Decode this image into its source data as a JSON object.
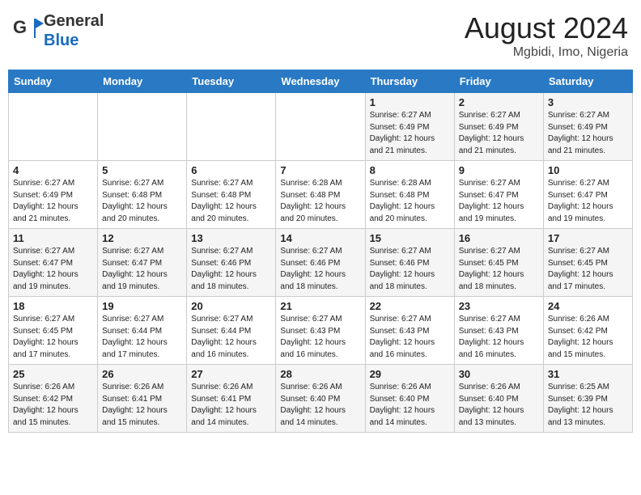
{
  "header": {
    "logo_general": "General",
    "logo_blue": "Blue",
    "month_year": "August 2024",
    "location": "Mgbidi, Imo, Nigeria"
  },
  "weekdays": [
    "Sunday",
    "Monday",
    "Tuesday",
    "Wednesday",
    "Thursday",
    "Friday",
    "Saturday"
  ],
  "weeks": [
    [
      {
        "day": "",
        "info": ""
      },
      {
        "day": "",
        "info": ""
      },
      {
        "day": "",
        "info": ""
      },
      {
        "day": "",
        "info": ""
      },
      {
        "day": "1",
        "info": "Sunrise: 6:27 AM\nSunset: 6:49 PM\nDaylight: 12 hours\nand 21 minutes."
      },
      {
        "day": "2",
        "info": "Sunrise: 6:27 AM\nSunset: 6:49 PM\nDaylight: 12 hours\nand 21 minutes."
      },
      {
        "day": "3",
        "info": "Sunrise: 6:27 AM\nSunset: 6:49 PM\nDaylight: 12 hours\nand 21 minutes."
      }
    ],
    [
      {
        "day": "4",
        "info": "Sunrise: 6:27 AM\nSunset: 6:49 PM\nDaylight: 12 hours\nand 21 minutes."
      },
      {
        "day": "5",
        "info": "Sunrise: 6:27 AM\nSunset: 6:48 PM\nDaylight: 12 hours\nand 20 minutes."
      },
      {
        "day": "6",
        "info": "Sunrise: 6:27 AM\nSunset: 6:48 PM\nDaylight: 12 hours\nand 20 minutes."
      },
      {
        "day": "7",
        "info": "Sunrise: 6:28 AM\nSunset: 6:48 PM\nDaylight: 12 hours\nand 20 minutes."
      },
      {
        "day": "8",
        "info": "Sunrise: 6:28 AM\nSunset: 6:48 PM\nDaylight: 12 hours\nand 20 minutes."
      },
      {
        "day": "9",
        "info": "Sunrise: 6:27 AM\nSunset: 6:47 PM\nDaylight: 12 hours\nand 19 minutes."
      },
      {
        "day": "10",
        "info": "Sunrise: 6:27 AM\nSunset: 6:47 PM\nDaylight: 12 hours\nand 19 minutes."
      }
    ],
    [
      {
        "day": "11",
        "info": "Sunrise: 6:27 AM\nSunset: 6:47 PM\nDaylight: 12 hours\nand 19 minutes."
      },
      {
        "day": "12",
        "info": "Sunrise: 6:27 AM\nSunset: 6:47 PM\nDaylight: 12 hours\nand 19 minutes."
      },
      {
        "day": "13",
        "info": "Sunrise: 6:27 AM\nSunset: 6:46 PM\nDaylight: 12 hours\nand 18 minutes."
      },
      {
        "day": "14",
        "info": "Sunrise: 6:27 AM\nSunset: 6:46 PM\nDaylight: 12 hours\nand 18 minutes."
      },
      {
        "day": "15",
        "info": "Sunrise: 6:27 AM\nSunset: 6:46 PM\nDaylight: 12 hours\nand 18 minutes."
      },
      {
        "day": "16",
        "info": "Sunrise: 6:27 AM\nSunset: 6:45 PM\nDaylight: 12 hours\nand 18 minutes."
      },
      {
        "day": "17",
        "info": "Sunrise: 6:27 AM\nSunset: 6:45 PM\nDaylight: 12 hours\nand 17 minutes."
      }
    ],
    [
      {
        "day": "18",
        "info": "Sunrise: 6:27 AM\nSunset: 6:45 PM\nDaylight: 12 hours\nand 17 minutes."
      },
      {
        "day": "19",
        "info": "Sunrise: 6:27 AM\nSunset: 6:44 PM\nDaylight: 12 hours\nand 17 minutes."
      },
      {
        "day": "20",
        "info": "Sunrise: 6:27 AM\nSunset: 6:44 PM\nDaylight: 12 hours\nand 16 minutes."
      },
      {
        "day": "21",
        "info": "Sunrise: 6:27 AM\nSunset: 6:43 PM\nDaylight: 12 hours\nand 16 minutes."
      },
      {
        "day": "22",
        "info": "Sunrise: 6:27 AM\nSunset: 6:43 PM\nDaylight: 12 hours\nand 16 minutes."
      },
      {
        "day": "23",
        "info": "Sunrise: 6:27 AM\nSunset: 6:43 PM\nDaylight: 12 hours\nand 16 minutes."
      },
      {
        "day": "24",
        "info": "Sunrise: 6:26 AM\nSunset: 6:42 PM\nDaylight: 12 hours\nand 15 minutes."
      }
    ],
    [
      {
        "day": "25",
        "info": "Sunrise: 6:26 AM\nSunset: 6:42 PM\nDaylight: 12 hours\nand 15 minutes."
      },
      {
        "day": "26",
        "info": "Sunrise: 6:26 AM\nSunset: 6:41 PM\nDaylight: 12 hours\nand 15 minutes."
      },
      {
        "day": "27",
        "info": "Sunrise: 6:26 AM\nSunset: 6:41 PM\nDaylight: 12 hours\nand 14 minutes."
      },
      {
        "day": "28",
        "info": "Sunrise: 6:26 AM\nSunset: 6:40 PM\nDaylight: 12 hours\nand 14 minutes."
      },
      {
        "day": "29",
        "info": "Sunrise: 6:26 AM\nSunset: 6:40 PM\nDaylight: 12 hours\nand 14 minutes."
      },
      {
        "day": "30",
        "info": "Sunrise: 6:26 AM\nSunset: 6:40 PM\nDaylight: 12 hours\nand 13 minutes."
      },
      {
        "day": "31",
        "info": "Sunrise: 6:25 AM\nSunset: 6:39 PM\nDaylight: 12 hours\nand 13 minutes."
      }
    ]
  ]
}
